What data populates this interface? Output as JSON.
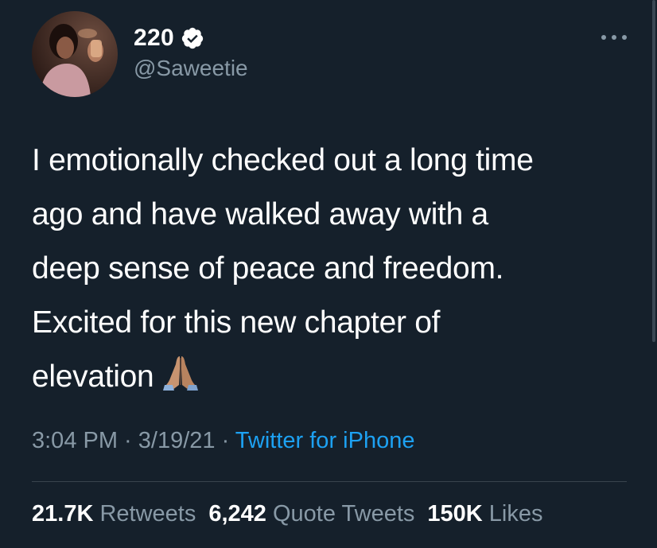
{
  "author": {
    "display_name": "220",
    "handle": "@Saweetie",
    "verified": true,
    "avatar_icon": "profile-photo"
  },
  "menu": {
    "icon": "more-options-icon"
  },
  "tweet": {
    "lines": [
      "I emotionally checked out a long time",
      "ago and have walked away with a",
      "deep sense of peace and freedom.",
      "Excited for this new chapter of",
      "elevation"
    ],
    "emoji": "🙏🏽",
    "emoji_icon": "folded-hands-icon"
  },
  "meta": {
    "time": "3:04 PM",
    "sep1": " · ",
    "date": "3/19/21",
    "sep2": " · ",
    "source": "Twitter for iPhone"
  },
  "stats": {
    "retweets": {
      "count": "21.7K",
      "label": "Retweets"
    },
    "quote_tweets": {
      "count": "6,242",
      "label": "Quote Tweets"
    },
    "likes": {
      "count": "150K",
      "label": "Likes"
    }
  },
  "colors": {
    "background": "#15202b",
    "secondary_text": "#8899a6",
    "link": "#1da1f2",
    "divider": "#38444d"
  }
}
